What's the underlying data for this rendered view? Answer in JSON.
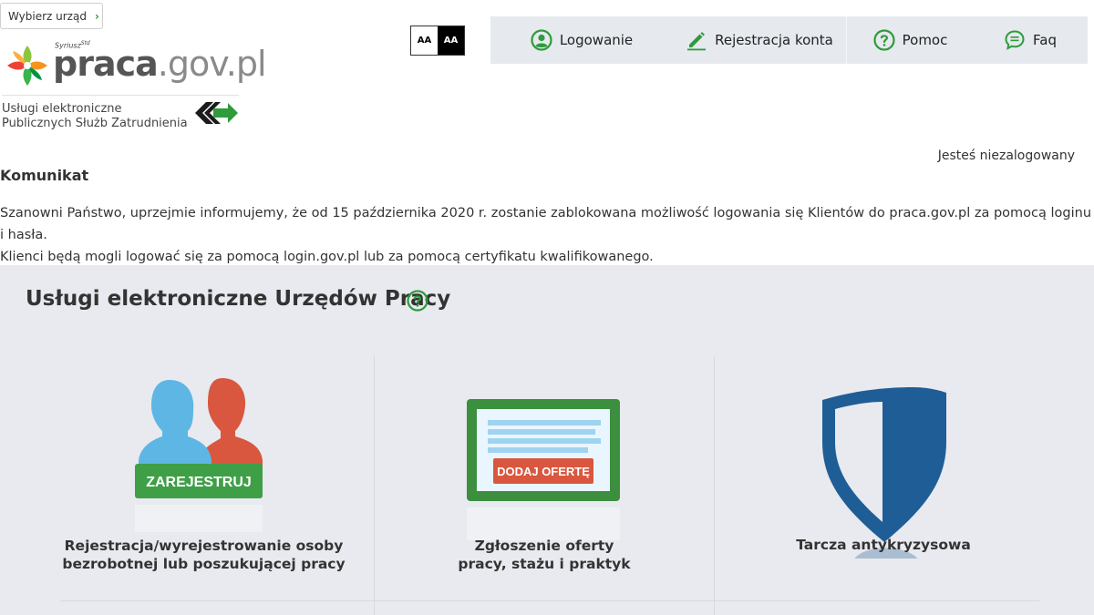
{
  "office_selector": {
    "label": "Wybierz urząd"
  },
  "logo": {
    "brand": "praca.gov.pl",
    "brand_prefix": "praca",
    "brand_suffix": ".gov.pl",
    "subbrand": "Syriusz",
    "subbrand_sup": "Std"
  },
  "services_tag": {
    "line1": "Usługi elektroniczne",
    "line2": "Publicznych Służb Zatrudnienia"
  },
  "contrast": {
    "normal": "AA",
    "high": "AA"
  },
  "topnav": [
    {
      "label": "Logowanie",
      "icon": "user-circle-icon"
    },
    {
      "label": "Rejestracja konta",
      "icon": "pencil-icon"
    },
    {
      "label": "Pomoc",
      "icon": "question-circle-icon"
    },
    {
      "label": "Faq",
      "icon": "chat-bubble-icon"
    }
  ],
  "login_status": "Jesteś niezalogowany",
  "message": {
    "title": "Komunikat",
    "line1": "Szanowni Państwo, uprzejmie informujemy, że od 15 października 2020 r. zostanie zablokowana możliwość logowania się Klientów do praca.gov.pl za pomocą loginu i hasła.",
    "line2": "Klienci będą mogli logować się za pomocą login.gov.pl lub za pomocą certyfikatu kwalifikowanego."
  },
  "services": {
    "title": "Usługi elektroniczne Urzędów Pracy",
    "tiles": [
      {
        "button": "ZAREJESTRUJ",
        "caption_line1": "Rejestracja/wyrejestrowanie osoby",
        "caption_line2": "bezrobotnej lub poszukującej pracy"
      },
      {
        "button": "DODAJ OFERTĘ",
        "caption_line1": "Zgłoszenie oferty",
        "caption_line2": "pracy, stażu i praktyk"
      },
      {
        "caption_line1": "Tarcza antykryzysowa"
      }
    ]
  },
  "colors": {
    "green": "#2e9b3c",
    "panel_bg": "#e8eaef",
    "nav_bg": "#e6e9ee",
    "shield_blue": "#1f5d96",
    "offer_red": "#d9573f"
  }
}
